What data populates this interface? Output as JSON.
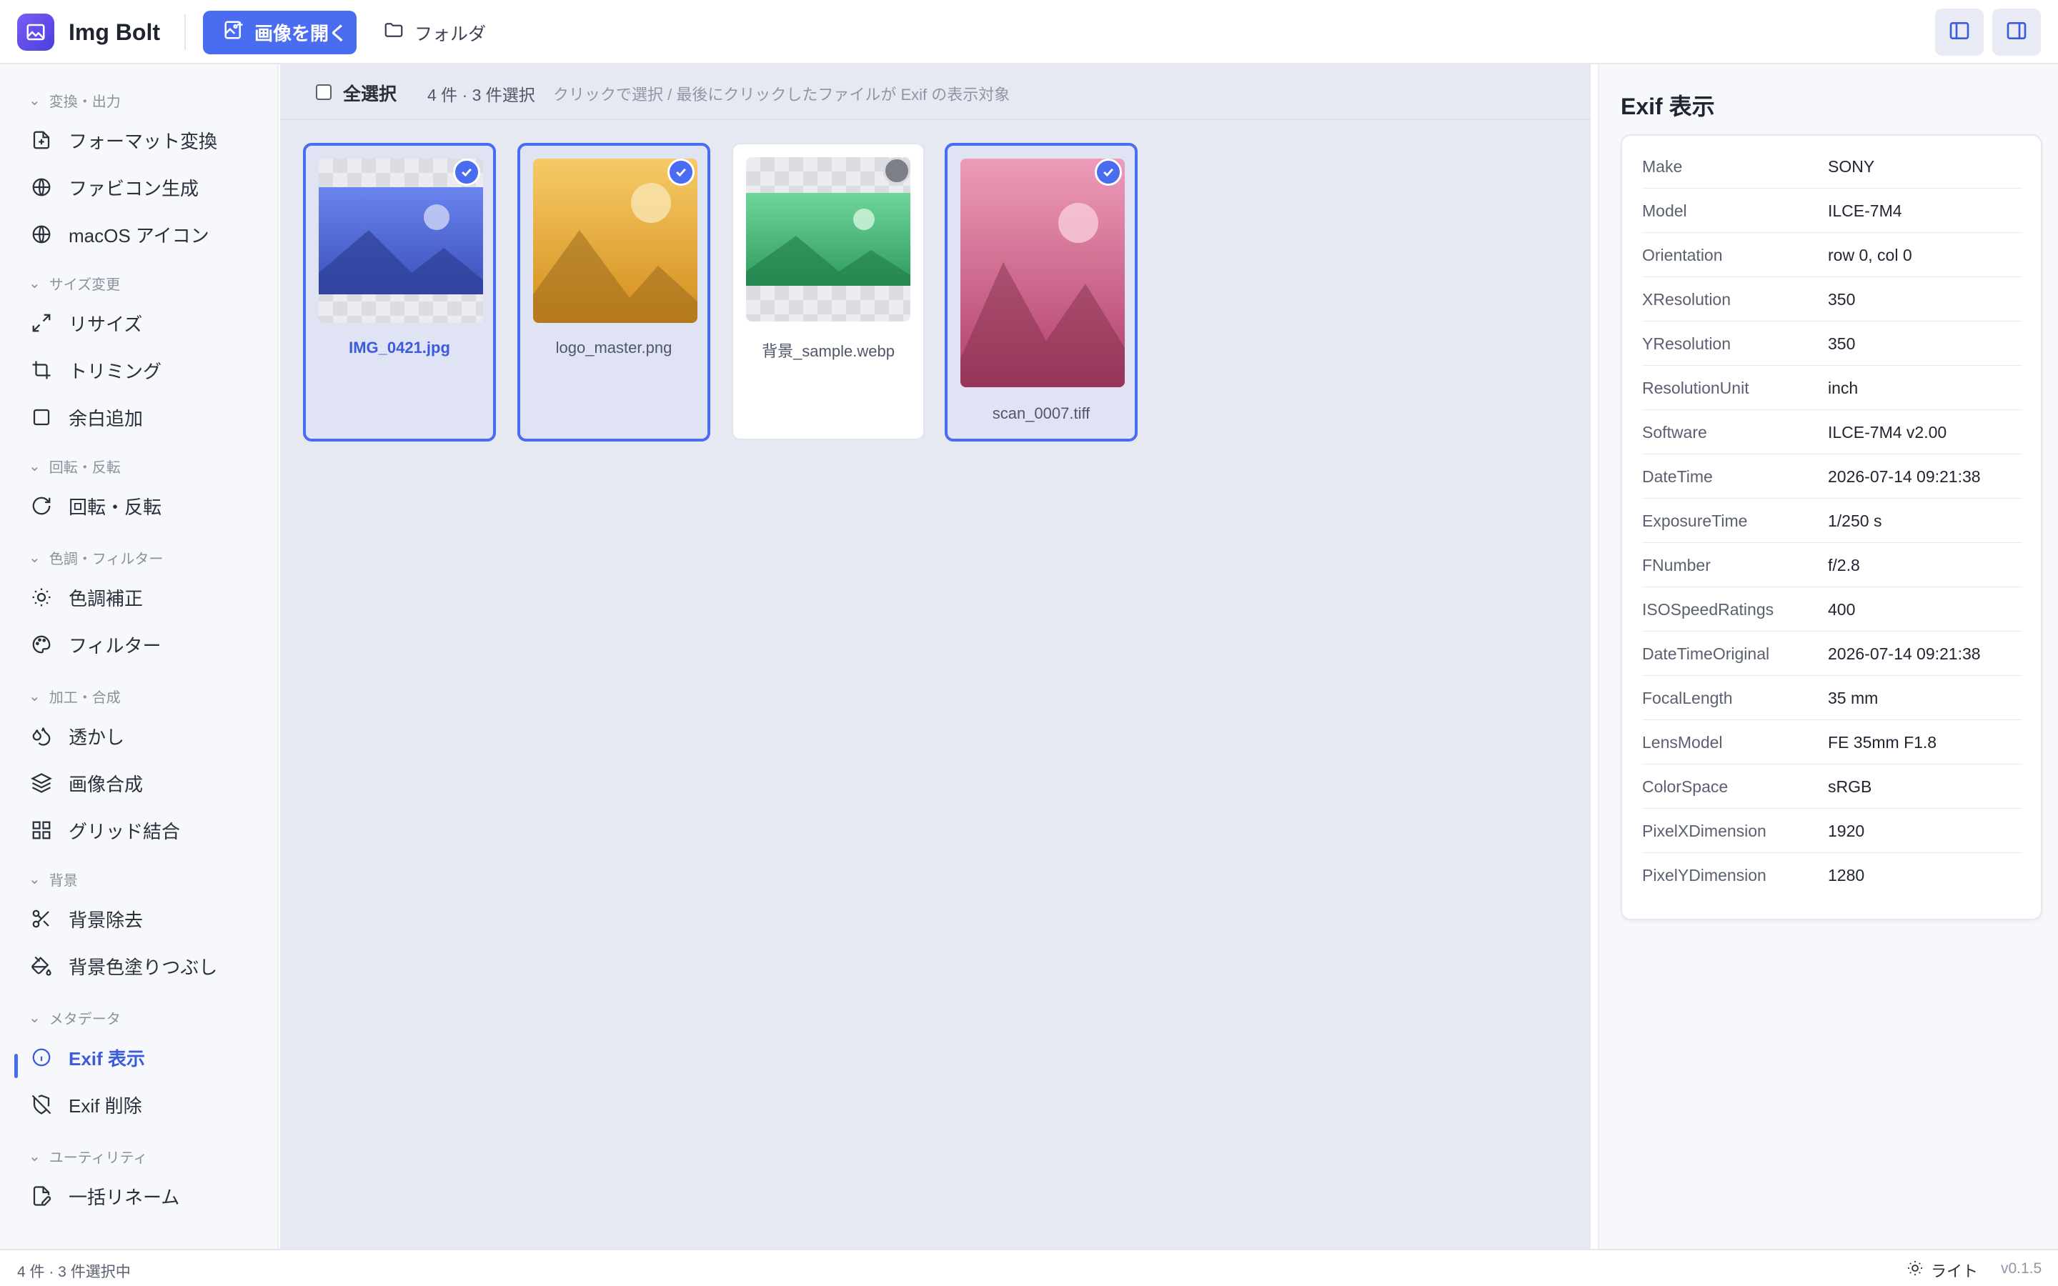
{
  "app": {
    "name": "Img Bolt"
  },
  "header": {
    "open_label": "画像を開く",
    "folder_label": "フォルダ"
  },
  "sidebar": {
    "groups": [
      {
        "label": "変換・出力",
        "items": [
          {
            "label": "フォーマット変換",
            "icon": "file-convert-icon"
          },
          {
            "label": "ファビコン生成",
            "icon": "globe-icon"
          },
          {
            "label": "macOS アイコン",
            "icon": "globe-icon"
          }
        ]
      },
      {
        "label": "サイズ変更",
        "items": [
          {
            "label": "リサイズ",
            "icon": "expand-icon"
          },
          {
            "label": "トリミング",
            "icon": "crop-icon"
          },
          {
            "label": "余白追加",
            "icon": "square-icon"
          }
        ]
      },
      {
        "label": "回転・反転",
        "items": [
          {
            "label": "回転・反転",
            "icon": "rotate-icon"
          }
        ]
      },
      {
        "label": "色調・フィルター",
        "items": [
          {
            "label": "色調補正",
            "icon": "sun-icon"
          },
          {
            "label": "フィルター",
            "icon": "palette-icon"
          }
        ]
      },
      {
        "label": "加工・合成",
        "items": [
          {
            "label": "透かし",
            "icon": "droplets-icon"
          },
          {
            "label": "画像合成",
            "icon": "layers-icon"
          },
          {
            "label": "グリッド結合",
            "icon": "grid-icon"
          }
        ]
      },
      {
        "label": "背景",
        "items": [
          {
            "label": "背景除去",
            "icon": "scissors-icon"
          },
          {
            "label": "背景色塗りつぶし",
            "icon": "paint-bucket-icon"
          }
        ]
      },
      {
        "label": "メタデータ",
        "items": [
          {
            "label": "Exif 表示",
            "icon": "info-icon"
          },
          {
            "label": "Exif 削除",
            "icon": "shield-off-icon"
          }
        ]
      },
      {
        "label": "ユーティリティ",
        "items": [
          {
            "label": "一括リネーム",
            "icon": "file-pen-icon"
          }
        ]
      }
    ],
    "active_item": "Exif 表示"
  },
  "toolbar": {
    "select_all": "全選択",
    "count": "4 件 · 3 件選択",
    "hint": "クリックで選択 / 最後にクリックしたファイルが Exif の表示対象"
  },
  "files": [
    {
      "name": "IMG_0421.jpg",
      "selected": true,
      "color_top": "#6a84f0",
      "color_bottom": "#3a4fb8"
    },
    {
      "name": "logo_master.png",
      "selected": true,
      "color_top": "#f2c25a",
      "color_bottom": "#d1921f"
    },
    {
      "name": "背景_sample.webp",
      "selected": false,
      "color_top": "#6fd69a",
      "color_bottom": "#2e9a5e"
    },
    {
      "name": "scan_0007.tiff",
      "selected": true,
      "color_top": "#e58aa8",
      "color_bottom": "#b5436d"
    }
  ],
  "exif_panel": {
    "title": "Exif 表示",
    "rows": [
      [
        "Make",
        "SONY"
      ],
      [
        "Model",
        "ILCE-7M4"
      ],
      [
        "Orientation",
        "row 0, col 0"
      ],
      [
        "XResolution",
        "350"
      ],
      [
        "YResolution",
        "350"
      ],
      [
        "ResolutionUnit",
        "inch"
      ],
      [
        "Software",
        "ILCE-7M4 v2.00"
      ],
      [
        "DateTime",
        "2026-07-14 09:21:38"
      ],
      [
        "ExposureTime",
        "1/250 s"
      ],
      [
        "FNumber",
        "f/2.8"
      ],
      [
        "ISOSpeedRatings",
        "400"
      ],
      [
        "DateTimeOriginal",
        "2026-07-14 09:21:38"
      ],
      [
        "FocalLength",
        "35 mm"
      ],
      [
        "LensModel",
        "FE 35mm F1.8"
      ],
      [
        "ColorSpace",
        "sRGB"
      ],
      [
        "PixelXDimension",
        "1920"
      ],
      [
        "PixelYDimension",
        "1280"
      ]
    ]
  },
  "statusbar": {
    "left": "4 件 · 3 件選択中",
    "theme": "ライト",
    "version": "v0.1.5"
  },
  "colors": {
    "accent": "#4a6cf0",
    "main_bg": "#e7e9f2"
  }
}
